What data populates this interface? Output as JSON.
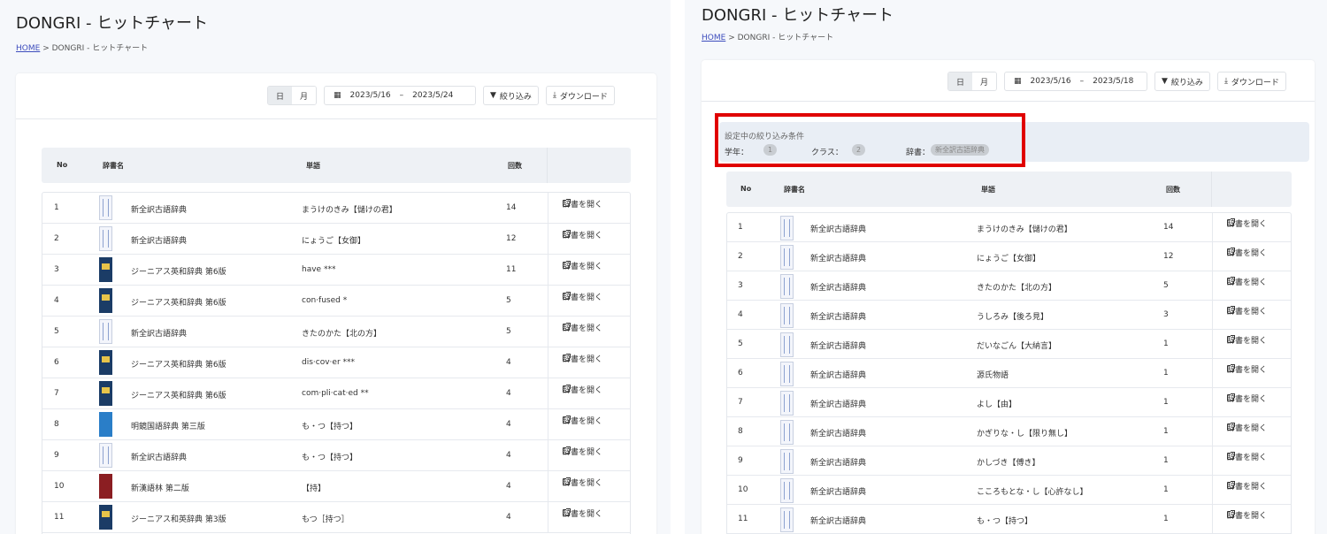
{
  "left": {
    "title": "DONGRI - ヒットチャート",
    "breadcrumb": {
      "home": "HOME",
      "separator": ">",
      "current": "DONGRI - ヒットチャート"
    },
    "toolbar": {
      "day": "日",
      "month": "月",
      "date_from": "2023/5/16",
      "dash": "–",
      "date_to": "2023/5/24",
      "filter": "絞り込み",
      "download": "ダウンロード"
    },
    "headers": {
      "no": "No",
      "dict": "辞書名",
      "word": "単語",
      "count": "回数"
    },
    "open_label": "辞書を開く",
    "rows": [
      {
        "no": "1",
        "dict": "新全訳古語辞典",
        "word": "まうけのきみ【儲けの君】",
        "count": "14",
        "thumb": "dict"
      },
      {
        "no": "2",
        "dict": "新全訳古語辞典",
        "word": "にょうご【女御】",
        "count": "12",
        "thumb": "dict"
      },
      {
        "no": "3",
        "dict": "ジーニアス英和辞典 第6版",
        "word": "have ***",
        "count": "11",
        "thumb": "blue"
      },
      {
        "no": "4",
        "dict": "ジーニアス英和辞典 第6版",
        "word": "con·fused *",
        "count": "5",
        "thumb": "blue"
      },
      {
        "no": "5",
        "dict": "新全訳古語辞典",
        "word": "きたのかた【北の方】",
        "count": "5",
        "thumb": "dict"
      },
      {
        "no": "6",
        "dict": "ジーニアス英和辞典 第6版",
        "word": "dis·cov·er ***",
        "count": "4",
        "thumb": "blue"
      },
      {
        "no": "7",
        "dict": "ジーニアス英和辞典 第6版",
        "word": "com·pli·cat·ed **",
        "count": "4",
        "thumb": "blue"
      },
      {
        "no": "8",
        "dict": "明鏡国語辞典 第三版",
        "word": "も・つ【持つ】",
        "count": "4",
        "thumb": "sky"
      },
      {
        "no": "9",
        "dict": "新全訳古語辞典",
        "word": "も・つ【持つ】",
        "count": "4",
        "thumb": "dict"
      },
      {
        "no": "10",
        "dict": "新漢語林 第二版",
        "word": "【持】",
        "count": "4",
        "thumb": "red"
      },
      {
        "no": "11",
        "dict": "ジーニアス和英辞典 第3版",
        "word": "もつ［持つ］",
        "count": "4",
        "thumb": "blue"
      }
    ]
  },
  "right": {
    "title": "DONGRI - ヒットチャート",
    "breadcrumb": {
      "home": "HOME",
      "separator": ">",
      "current": "DONGRI - ヒットチャート"
    },
    "toolbar": {
      "day": "日",
      "month": "月",
      "date_from": "2023/5/16",
      "dash": "–",
      "date_to": "2023/5/18",
      "filter": "絞り込み",
      "download": "ダウンロード"
    },
    "filter_conditions": {
      "title": "設定中の絞り込み条件",
      "grade_label": "学年：",
      "grade_value": "1",
      "class_label": "クラス：",
      "class_value": "2",
      "dict_label": "辞書：",
      "dict_value": "新全訳古語辞典"
    },
    "headers": {
      "no": "No",
      "dict": "辞書名",
      "word": "単語",
      "count": "回数"
    },
    "open_label": "辞書を開く",
    "rows": [
      {
        "no": "1",
        "dict": "新全訳古語辞典",
        "word": "まうけのきみ【儲けの君】",
        "count": "14"
      },
      {
        "no": "2",
        "dict": "新全訳古語辞典",
        "word": "にょうご【女御】",
        "count": "12"
      },
      {
        "no": "3",
        "dict": "新全訳古語辞典",
        "word": "きたのかた【北の方】",
        "count": "5"
      },
      {
        "no": "4",
        "dict": "新全訳古語辞典",
        "word": "うしろみ【後ろ見】",
        "count": "3"
      },
      {
        "no": "5",
        "dict": "新全訳古語辞典",
        "word": "だいなごん【大納言】",
        "count": "1"
      },
      {
        "no": "6",
        "dict": "新全訳古語辞典",
        "word": "源氏物語",
        "count": "1"
      },
      {
        "no": "7",
        "dict": "新全訳古語辞典",
        "word": "よし【由】",
        "count": "1"
      },
      {
        "no": "8",
        "dict": "新全訳古語辞典",
        "word": "かぎりな・し【限り無し】",
        "count": "1"
      },
      {
        "no": "9",
        "dict": "新全訳古語辞典",
        "word": "かしづき【傅き】",
        "count": "1"
      },
      {
        "no": "10",
        "dict": "新全訳古語辞典",
        "word": "こころもとな・し【心許なし】",
        "count": "1"
      },
      {
        "no": "11",
        "dict": "新全訳古語辞典",
        "word": "も・つ【持つ】",
        "count": "1"
      }
    ]
  },
  "colors": {
    "accent_red": "#e00000",
    "link_blue": "#3d4dbd",
    "header_bg": "#eef1f5"
  }
}
